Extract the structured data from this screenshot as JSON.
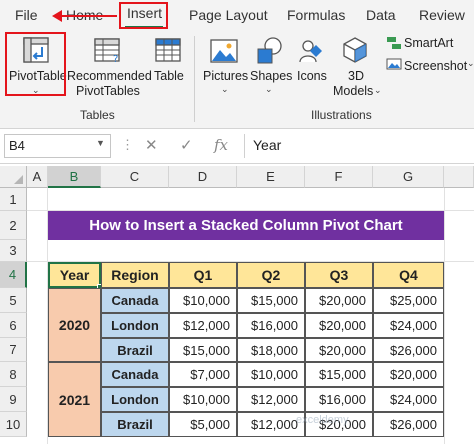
{
  "tabs": [
    "File",
    "Home",
    "Insert",
    "Page Layout",
    "Formulas",
    "Data",
    "Review"
  ],
  "ribbon": {
    "tables_group": {
      "label": "Tables",
      "pivot_table": "PivotTable",
      "recommended_line1": "Recommended",
      "recommended_line2": "PivotTables",
      "table": "Table"
    },
    "illustrations_group": {
      "label": "Illustrations",
      "pictures": "Pictures",
      "shapes": "Shapes",
      "icons": "Icons",
      "models_line1": "3D",
      "models_line2": "Models",
      "smartart": "SmartArt",
      "screenshot": "Screenshot"
    }
  },
  "formula_bar": {
    "name_box": "B4",
    "fx": "fx",
    "content": "Year"
  },
  "columns": [
    "A",
    "B",
    "C",
    "D",
    "E",
    "F",
    "G"
  ],
  "rows": [
    "1",
    "2",
    "3",
    "4",
    "5",
    "6",
    "7",
    "8",
    "9",
    "10"
  ],
  "sheet": {
    "title": "How to Insert a Stacked Column Pivot Chart",
    "headers": [
      "Year",
      "Region",
      "Q1",
      "Q2",
      "Q3",
      "Q4"
    ],
    "years": [
      "2020",
      "2021"
    ],
    "data": [
      {
        "region": "Canada",
        "q": [
          "$10,000",
          "$15,000",
          "$20,000",
          "$25,000"
        ]
      },
      {
        "region": "London",
        "q": [
          "$12,000",
          "$16,000",
          "$20,000",
          "$24,000"
        ]
      },
      {
        "region": "Brazil",
        "q": [
          "$15,000",
          "$18,000",
          "$20,000",
          "$26,000"
        ]
      },
      {
        "region": "Canada",
        "q": [
          "$7,000",
          "$10,000",
          "$15,000",
          "$20,000"
        ]
      },
      {
        "region": "London",
        "q": [
          "$10,000",
          "$12,000",
          "$16,000",
          "$24,000"
        ]
      },
      {
        "region": "Brazil",
        "q": [
          "$5,000",
          "$12,000",
          "$20,000",
          "$26,000"
        ]
      }
    ]
  },
  "watermark": "exceldemy",
  "colors": {
    "accent": "#217346",
    "highlight": "#e4141b",
    "title_bg": "#7030a0",
    "header_bg": "#ffe699",
    "year_bg": "#f8cbad",
    "region_bg": "#bdd7ee"
  }
}
